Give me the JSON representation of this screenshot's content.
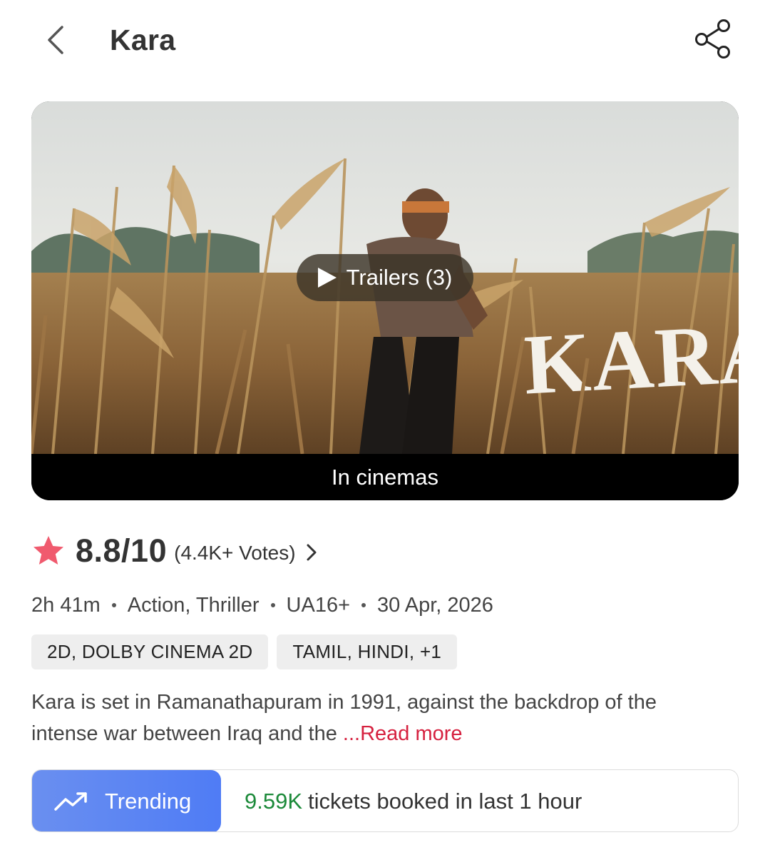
{
  "header": {
    "title": "Kara",
    "back_icon": "chevron-left-icon",
    "share_icon": "share-icon"
  },
  "banner": {
    "trailer_label": "Trailers (3)",
    "status_label": "In cinemas",
    "poster_logo_text": "KARA"
  },
  "rating": {
    "value": "8.8/10",
    "votes": "(4.4K+ Votes)",
    "star_color": "#f05a6e"
  },
  "meta": {
    "duration": "2h 41m",
    "genres": "Action, Thriller",
    "certificate": "UA16+",
    "release_date": "30 Apr, 2026"
  },
  "tags": {
    "formats": "2D, DOLBY CINEMA 2D",
    "languages": "TAMIL, HINDI,  +1"
  },
  "synopsis": {
    "line1": "Kara is set in Ramanathapuram in 1991, against the backdrop of the",
    "line2": "intense war between Iraq and the ",
    "read_more": "...Read more"
  },
  "trending": {
    "badge_label": "Trending",
    "count": "9.59K",
    "text": "tickets booked in last 1 hour",
    "badge_color": "#5b84f2",
    "count_color": "#1c8a3a"
  }
}
